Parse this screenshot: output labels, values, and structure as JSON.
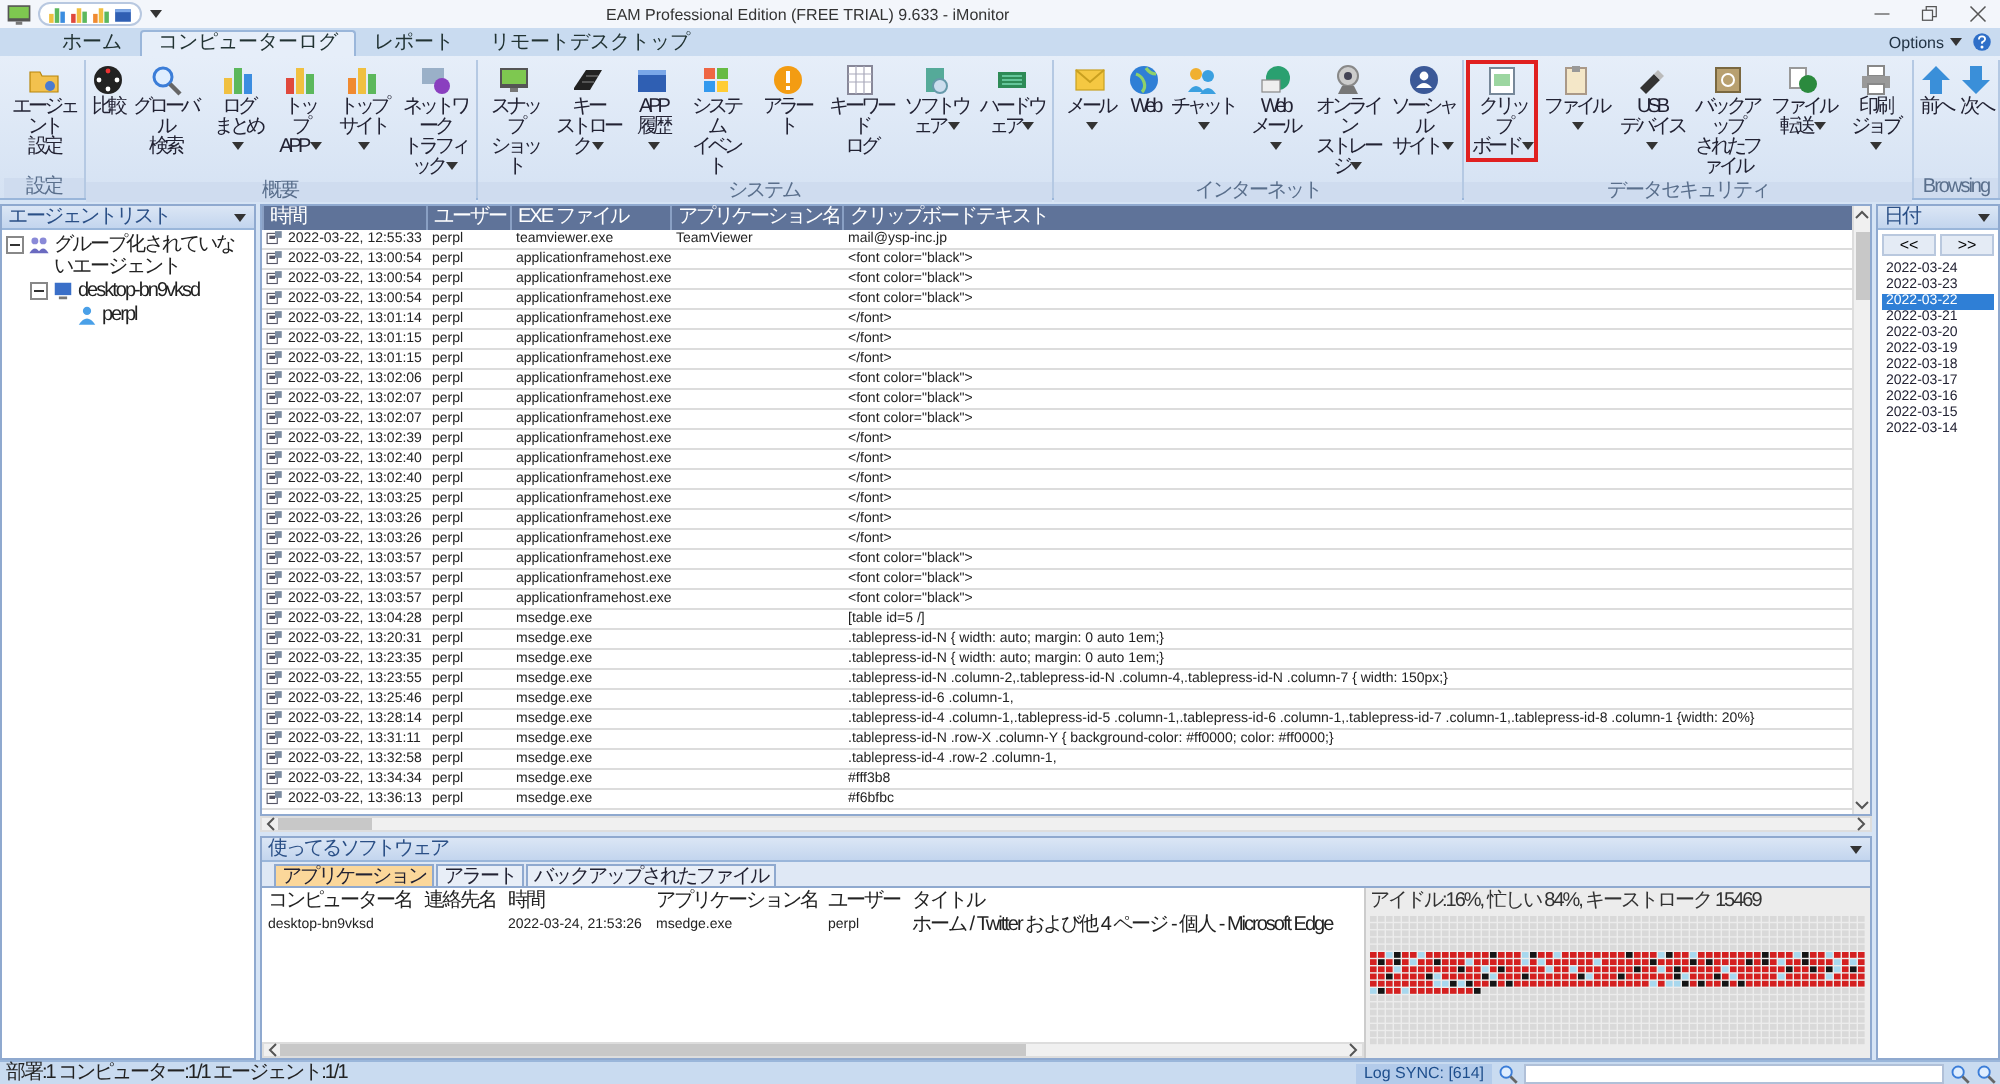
{
  "window": {
    "title": "EAM Professional Edition (FREE TRIAL) 9.633 - iMonitor"
  },
  "tabs": [
    {
      "label": "ホーム",
      "selected": false
    },
    {
      "label": "コンピューターログ",
      "selected": true
    },
    {
      "label": "レポート",
      "selected": false
    },
    {
      "label": "リモートデスクトップ",
      "selected": false
    }
  ],
  "options": {
    "label": "Options"
  },
  "ribbon": {
    "groups": [
      {
        "label": "設定",
        "buttons": [
          {
            "lines": [
              "エージェント",
              "設定"
            ],
            "dropdown": false,
            "selected": false
          }
        ]
      },
      {
        "label": "概要",
        "buttons": [
          {
            "lines": [
              "比較"
            ],
            "dropdown": false,
            "selected": false
          },
          {
            "lines": [
              "グローバル",
              "検索"
            ],
            "dropdown": false,
            "selected": false
          },
          {
            "lines": [
              "ログ",
              "まとめ"
            ],
            "dropdown": true,
            "selected": false
          },
          {
            "lines": [
              "トップ",
              "APP"
            ],
            "dropdown": true,
            "selected": false
          },
          {
            "lines": [
              "トップ",
              "サイト"
            ],
            "dropdown": true,
            "selected": false
          },
          {
            "lines": [
              "ネットワーク",
              "トラフィック"
            ],
            "dropdown": true,
            "selected": false
          }
        ]
      },
      {
        "label": "システム",
        "buttons": [
          {
            "lines": [
              "スナップ",
              "ショット"
            ],
            "dropdown": false,
            "selected": false
          },
          {
            "lines": [
              "キー",
              "ストローク"
            ],
            "dropdown": true,
            "selected": false
          },
          {
            "lines": [
              "APP",
              "履歴"
            ],
            "dropdown": true,
            "selected": false
          },
          {
            "lines": [
              "システム",
              "イベント"
            ],
            "dropdown": false,
            "selected": false
          },
          {
            "lines": [
              "アラート"
            ],
            "dropdown": false,
            "selected": false
          },
          {
            "lines": [
              "キーワード",
              "ログ"
            ],
            "dropdown": false,
            "selected": false
          },
          {
            "lines": [
              "ソフトウェア"
            ],
            "dropdown": true,
            "selected": false
          },
          {
            "lines": [
              "ハードウェア"
            ],
            "dropdown": true,
            "selected": false
          }
        ]
      },
      {
        "label": "インターネット",
        "buttons": [
          {
            "lines": [
              "メール"
            ],
            "dropdown": true,
            "selected": false
          },
          {
            "lines": [
              "Web"
            ],
            "dropdown": false,
            "selected": false
          },
          {
            "lines": [
              "チャット"
            ],
            "dropdown": true,
            "selected": false
          },
          {
            "lines": [
              "Web",
              "メール"
            ],
            "dropdown": true,
            "selected": false
          },
          {
            "lines": [
              "オンライン",
              "ストレージ"
            ],
            "dropdown": true,
            "selected": false
          },
          {
            "lines": [
              "ソーシャル",
              "サイト"
            ],
            "dropdown": true,
            "selected": false
          }
        ]
      },
      {
        "label": "データセキュリティ",
        "buttons": [
          {
            "lines": [
              "クリップ",
              "ボード"
            ],
            "dropdown": true,
            "selected": true
          },
          {
            "lines": [
              "ファイル"
            ],
            "dropdown": true,
            "selected": false
          },
          {
            "lines": [
              "USB",
              "デバイス"
            ],
            "dropdown": true,
            "selected": false
          },
          {
            "lines": [
              "バックアップ",
              "されたファイル"
            ],
            "dropdown": false,
            "selected": false
          },
          {
            "lines": [
              "ファイル転送"
            ],
            "dropdown": true,
            "selected": false
          },
          {
            "lines": [
              "印刷",
              "ジョブ"
            ],
            "dropdown": true,
            "selected": false
          }
        ]
      },
      {
        "label": "Browsing",
        "buttons": [
          {
            "lines": [
              "前へ"
            ],
            "dropdown": false,
            "selected": false
          },
          {
            "lines": [
              "次へ"
            ],
            "dropdown": false,
            "selected": false
          }
        ]
      }
    ]
  },
  "agent_list": {
    "title": "エージェントリスト",
    "tree": [
      {
        "label": "グループ化されていないエージェント",
        "expanded": true,
        "children": [
          {
            "label": "desktop-bn9vksd",
            "expanded": true,
            "children": [
              {
                "label": "perpl"
              }
            ]
          }
        ]
      }
    ]
  },
  "table": {
    "columns": [
      "時間",
      "ユーザー",
      "EXE ファイル",
      "アプリケーション名",
      "クリップボードテキスト"
    ],
    "rows": [
      {
        "time": "2022-03-22, 12:55:33",
        "user": "perpl",
        "exe": "teamviewer.exe",
        "app": "TeamViewer",
        "text": "mail@ysp-inc.jp"
      },
      {
        "time": "2022-03-22, 13:00:54",
        "user": "perpl",
        "exe": "applicationframehost.exe",
        "text": "<font color=\"black\">"
      },
      {
        "time": "2022-03-22, 13:00:54",
        "user": "perpl",
        "exe": "applicationframehost.exe",
        "text": "<font color=\"black\">"
      },
      {
        "time": "2022-03-22, 13:00:54",
        "user": "perpl",
        "exe": "applicationframehost.exe",
        "text": "<font color=\"black\">"
      },
      {
        "time": "2022-03-22, 13:01:14",
        "user": "perpl",
        "exe": "applicationframehost.exe",
        "text": "</font>"
      },
      {
        "time": "2022-03-22, 13:01:15",
        "user": "perpl",
        "exe": "applicationframehost.exe",
        "text": "</font>"
      },
      {
        "time": "2022-03-22, 13:01:15",
        "user": "perpl",
        "exe": "applicationframehost.exe",
        "text": "</font>"
      },
      {
        "time": "2022-03-22, 13:02:06",
        "user": "perpl",
        "exe": "applicationframehost.exe",
        "text": "<font color=\"black\">"
      },
      {
        "time": "2022-03-22, 13:02:07",
        "user": "perpl",
        "exe": "applicationframehost.exe",
        "text": "<font color=\"black\">"
      },
      {
        "time": "2022-03-22, 13:02:07",
        "user": "perpl",
        "exe": "applicationframehost.exe",
        "text": "<font color=\"black\">"
      },
      {
        "time": "2022-03-22, 13:02:39",
        "user": "perpl",
        "exe": "applicationframehost.exe",
        "text": "</font>"
      },
      {
        "time": "2022-03-22, 13:02:40",
        "user": "perpl",
        "exe": "applicationframehost.exe",
        "text": "</font>"
      },
      {
        "time": "2022-03-22, 13:02:40",
        "user": "perpl",
        "exe": "applicationframehost.exe",
        "text": "</font>"
      },
      {
        "time": "2022-03-22, 13:03:25",
        "user": "perpl",
        "exe": "applicationframehost.exe",
        "text": "</font>"
      },
      {
        "time": "2022-03-22, 13:03:26",
        "user": "perpl",
        "exe": "applicationframehost.exe",
        "text": "</font>"
      },
      {
        "time": "2022-03-22, 13:03:26",
        "user": "perpl",
        "exe": "applicationframehost.exe",
        "text": "</font>"
      },
      {
        "time": "2022-03-22, 13:03:57",
        "user": "perpl",
        "exe": "applicationframehost.exe",
        "text": "<font color=\"black\">"
      },
      {
        "time": "2022-03-22, 13:03:57",
        "user": "perpl",
        "exe": "applicationframehost.exe",
        "text": "<font color=\"black\">"
      },
      {
        "time": "2022-03-22, 13:03:57",
        "user": "perpl",
        "exe": "applicationframehost.exe",
        "text": "<font color=\"black\">"
      },
      {
        "time": "2022-03-22, 13:04:28",
        "user": "perpl",
        "exe": "msedge.exe",
        "text": "[table id=5 /]"
      },
      {
        "time": "2022-03-22, 13:20:31",
        "user": "perpl",
        "exe": "msedge.exe",
        "text": ".tablepress-id-N { width: auto; margin: 0 auto 1em;}"
      },
      {
        "time": "2022-03-22, 13:23:35",
        "user": "perpl",
        "exe": "msedge.exe",
        "text": ".tablepress-id-N { width: auto; margin: 0 auto 1em;}"
      },
      {
        "time": "2022-03-22, 13:23:55",
        "user": "perpl",
        "exe": "msedge.exe",
        "text": ".tablepress-id-N .column-2,.tablepress-id-N .column-4,.tablepress-id-N .column-7 {  width: 150px;}"
      },
      {
        "time": "2022-03-22, 13:25:46",
        "user": "perpl",
        "exe": "msedge.exe",
        "text": ".tablepress-id-6 .column-1,"
      },
      {
        "time": "2022-03-22, 13:28:14",
        "user": "perpl",
        "exe": "msedge.exe",
        "text": ".tablepress-id-4 .column-1,.tablepress-id-5 .column-1,.tablepress-id-6 .column-1,.tablepress-id-7 .column-1,.tablepress-id-8 .column-1 {width: 20%}"
      },
      {
        "time": "2022-03-22, 13:31:11",
        "user": "perpl",
        "exe": "msedge.exe",
        "text": ".tablepress-id-N .row-X .column-Y {  background-color: #ff0000;  color: #ff0000;}"
      },
      {
        "time": "2022-03-22, 13:32:58",
        "user": "perpl",
        "exe": "msedge.exe",
        "text": ".tablepress-id-4 .row-2 .column-1,"
      },
      {
        "time": "2022-03-22, 13:34:34",
        "user": "perpl",
        "exe": "msedge.exe",
        "text": "#fff3b8"
      },
      {
        "time": "2022-03-22, 13:36:13",
        "user": "perpl",
        "exe": "msedge.exe",
        "text": "#f6bfbc"
      }
    ]
  },
  "date_panel": {
    "title": "日付",
    "prev": "<<",
    "next": ">>",
    "dates": [
      {
        "label": "2022-03-24",
        "selected": false
      },
      {
        "label": "2022-03-23",
        "selected": false
      },
      {
        "label": "2022-03-22",
        "selected": true
      },
      {
        "label": "2022-03-21",
        "selected": false
      },
      {
        "label": "2022-03-20",
        "selected": false
      },
      {
        "label": "2022-03-19",
        "selected": false
      },
      {
        "label": "2022-03-18",
        "selected": false
      },
      {
        "label": "2022-03-17",
        "selected": false
      },
      {
        "label": "2022-03-16",
        "selected": false
      },
      {
        "label": "2022-03-15",
        "selected": false
      },
      {
        "label": "2022-03-14",
        "selected": false
      }
    ]
  },
  "bottom_panel": {
    "title": "使ってるソフトウェア",
    "tabs": [
      {
        "label": "アプリケーション",
        "selected": true
      },
      {
        "label": "アラート",
        "selected": false
      },
      {
        "label": "バックアップされたファイル",
        "selected": false
      }
    ],
    "columns": [
      "コンピューター名",
      "連絡先名",
      "時間",
      "アプリケーション名",
      "ユーザー",
      "タイトル"
    ],
    "rows": [
      {
        "computer": "desktop-bn9vksd",
        "time": "2022-03-24, 21:53:26",
        "app": "msedge.exe",
        "user": "perpl",
        "title": "ホーム / Twitter および他 4 ページ - 個人 - Microsoft Edge"
      }
    ],
    "activity": {
      "summary": "アイドル:16%, 忙しい 84%, キーストローク 15469"
    }
  },
  "status_bar": {
    "counts": "部署:1 コンピューター:1/1 エージェント:1/1",
    "log_sync": "Log SYNC: [614]"
  }
}
